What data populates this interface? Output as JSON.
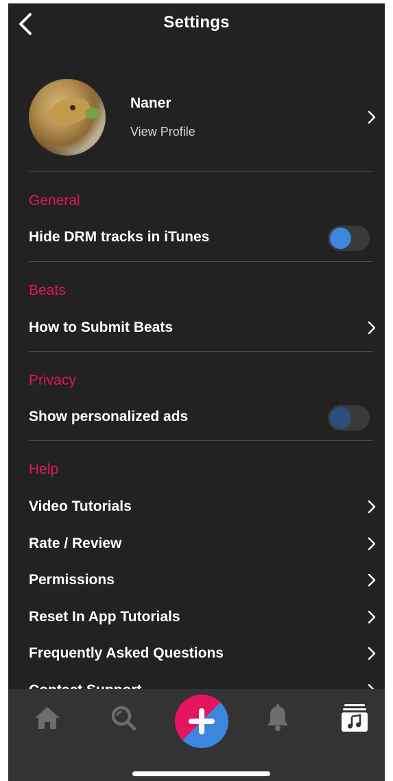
{
  "header": {
    "title": "Settings",
    "back_icon": "chevron-left-icon"
  },
  "profile": {
    "name": "Naner",
    "subtitle": "View Profile",
    "avatar_icon": "lizard-avatar"
  },
  "sections": {
    "general": {
      "title": "General",
      "items": [
        {
          "label": "Hide DRM tracks in iTunes",
          "type": "toggle",
          "enabled": true
        }
      ]
    },
    "beats": {
      "title": "Beats",
      "items": [
        {
          "label": "How to Submit Beats",
          "type": "link"
        }
      ]
    },
    "privacy": {
      "title": "Privacy",
      "items": [
        {
          "label": "Show personalized ads",
          "type": "toggle",
          "enabled": false
        }
      ]
    },
    "help": {
      "title": "Help",
      "items": [
        {
          "label": "Video Tutorials",
          "type": "link"
        },
        {
          "label": "Rate / Review",
          "type": "link"
        },
        {
          "label": "Permissions",
          "type": "link"
        },
        {
          "label": "Reset In App Tutorials",
          "type": "link"
        },
        {
          "label": "Frequently Asked Questions",
          "type": "link"
        },
        {
          "label": "Contact Support",
          "type": "link"
        }
      ]
    }
  },
  "tabbar": {
    "items": [
      {
        "icon": "home-icon"
      },
      {
        "icon": "search-icon"
      },
      {
        "icon": "add-icon"
      },
      {
        "icon": "bell-icon"
      },
      {
        "icon": "music-library-icon",
        "active": true
      }
    ]
  },
  "colors": {
    "background": "#222223",
    "accent_pink": "#e4145f",
    "accent_blue": "#3d86de",
    "tabbar": "#333335",
    "inactive_icon": "#6d6d70"
  }
}
